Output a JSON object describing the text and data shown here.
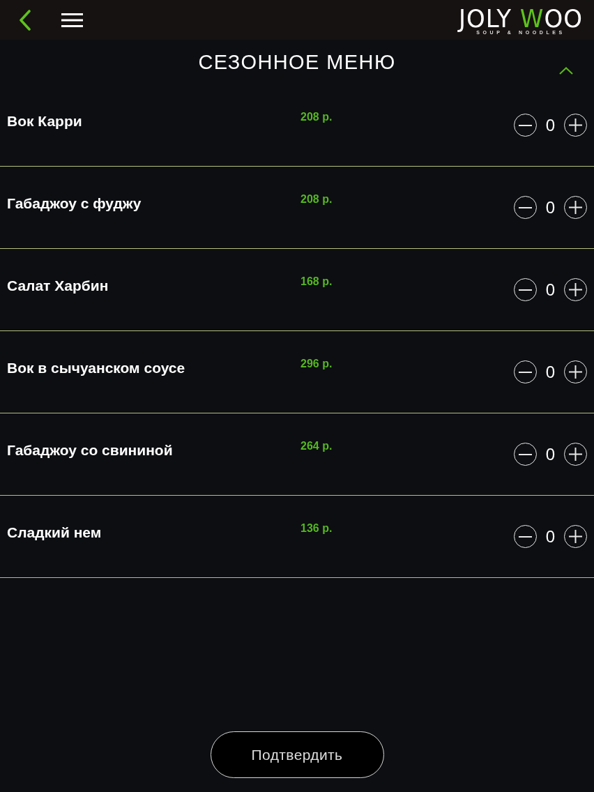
{
  "header": {
    "logo": {
      "name_start": "JOLY",
      "name_accent": "W",
      "name_end": "OO",
      "tagline": "SOUP & NOODLES"
    }
  },
  "section": {
    "title": "СЕЗОННОЕ МЕНЮ",
    "expanded": true
  },
  "items": [
    {
      "name": "Вок Карри",
      "price": "208 р.",
      "quantity": "0"
    },
    {
      "name": "Габаджоу с фуджу",
      "price": "208 р.",
      "quantity": "0"
    },
    {
      "name": "Салат Харбин",
      "price": "168 р.",
      "quantity": "0"
    },
    {
      "name": "Вок в сычуанском соусе",
      "price": "296 р.",
      "quantity": "0"
    },
    {
      "name": "Габаджоу со свининой",
      "price": "264 р.",
      "quantity": "0"
    },
    {
      "name": "Сладкий нем",
      "price": "136 р.",
      "quantity": "0"
    }
  ],
  "confirm_button": {
    "label": "Подтвердить"
  }
}
